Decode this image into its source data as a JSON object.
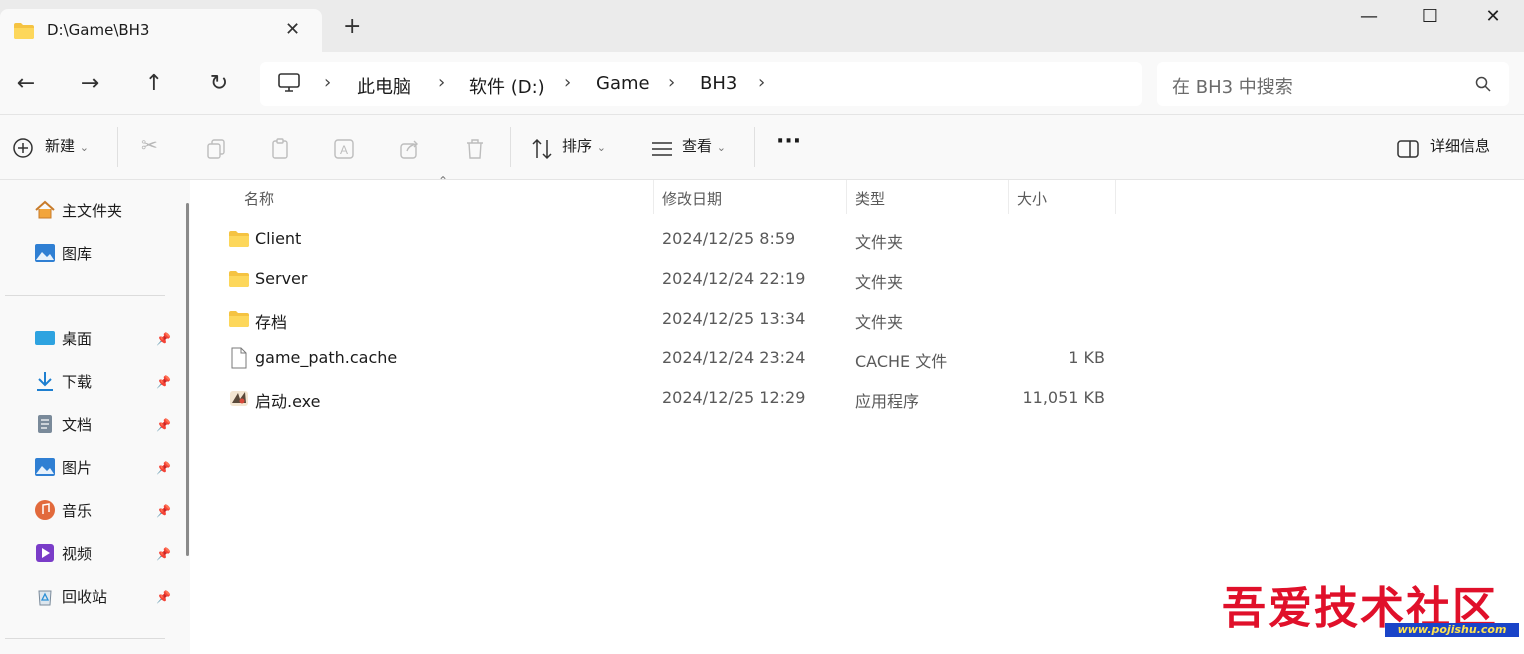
{
  "window": {
    "tab_title": "D:\\Game\\BH3",
    "minimize": "—",
    "maximize": "☐",
    "close": "✕"
  },
  "nav": {
    "breadcrumb": [
      "此电脑",
      "软件 (D:)",
      "Game",
      "BH3"
    ],
    "search_placeholder": "在 BH3 中搜索"
  },
  "toolbar": {
    "new_label": "新建",
    "sort_label": "排序",
    "view_label": "查看",
    "more_label": "···",
    "details_label": "详细信息"
  },
  "sidebar": {
    "quick": [
      {
        "label": "主文件夹",
        "icon": "home-icon"
      },
      {
        "label": "图库",
        "icon": "gallery-icon"
      }
    ],
    "pinned": [
      {
        "label": "桌面",
        "icon": "desktop-icon"
      },
      {
        "label": "下载",
        "icon": "download-icon"
      },
      {
        "label": "文档",
        "icon": "document-icon"
      },
      {
        "label": "图片",
        "icon": "pictures-icon"
      },
      {
        "label": "音乐",
        "icon": "music-icon"
      },
      {
        "label": "视频",
        "icon": "video-icon"
      },
      {
        "label": "回收站",
        "icon": "recycle-bin-icon"
      }
    ]
  },
  "file_list": {
    "columns": {
      "name": "名称",
      "date": "修改日期",
      "type": "类型",
      "size": "大小"
    },
    "rows": [
      {
        "name": "Client",
        "date": "2024/12/25 8:59",
        "type": "文件夹",
        "size": "",
        "icon": "folder-icon"
      },
      {
        "name": "Server",
        "date": "2024/12/24 22:19",
        "type": "文件夹",
        "size": "",
        "icon": "folder-icon"
      },
      {
        "name": "存档",
        "date": "2024/12/25 13:34",
        "type": "文件夹",
        "size": "",
        "icon": "folder-icon"
      },
      {
        "name": "game_path.cache",
        "date": "2024/12/24 23:24",
        "type": "CACHE 文件",
        "size": "1 KB",
        "icon": "file-icon"
      },
      {
        "name": "启动.exe",
        "date": "2024/12/25 12:29",
        "type": "应用程序",
        "size": "11,051 KB",
        "icon": "exe-icon"
      }
    ]
  },
  "watermark": {
    "text": "吾爱技术社区",
    "url": "www.pojishu.com"
  }
}
